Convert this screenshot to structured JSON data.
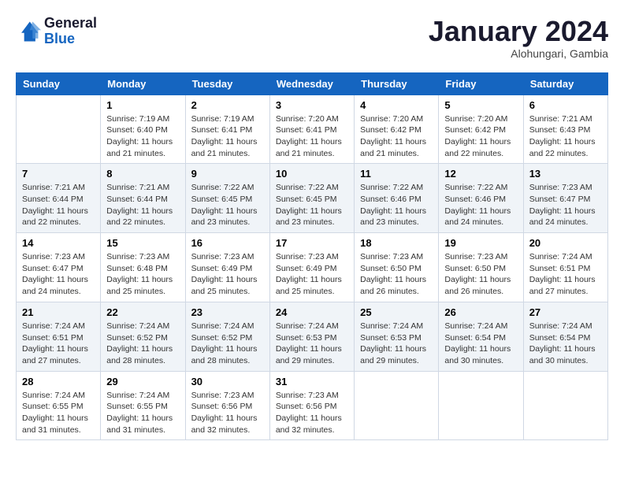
{
  "header": {
    "logo_general": "General",
    "logo_blue": "Blue",
    "month_title": "January 2024",
    "subtitle": "Alohungari, Gambia"
  },
  "weekdays": [
    "Sunday",
    "Monday",
    "Tuesday",
    "Wednesday",
    "Thursday",
    "Friday",
    "Saturday"
  ],
  "weeks": [
    [
      {
        "day": null
      },
      {
        "day": 1,
        "sunrise": "7:19 AM",
        "sunset": "6:40 PM",
        "daylight": "11 hours and 21 minutes."
      },
      {
        "day": 2,
        "sunrise": "7:19 AM",
        "sunset": "6:41 PM",
        "daylight": "11 hours and 21 minutes."
      },
      {
        "day": 3,
        "sunrise": "7:20 AM",
        "sunset": "6:41 PM",
        "daylight": "11 hours and 21 minutes."
      },
      {
        "day": 4,
        "sunrise": "7:20 AM",
        "sunset": "6:42 PM",
        "daylight": "11 hours and 21 minutes."
      },
      {
        "day": 5,
        "sunrise": "7:20 AM",
        "sunset": "6:42 PM",
        "daylight": "11 hours and 22 minutes."
      },
      {
        "day": 6,
        "sunrise": "7:21 AM",
        "sunset": "6:43 PM",
        "daylight": "11 hours and 22 minutes."
      }
    ],
    [
      {
        "day": 7,
        "sunrise": "7:21 AM",
        "sunset": "6:44 PM",
        "daylight": "11 hours and 22 minutes."
      },
      {
        "day": 8,
        "sunrise": "7:21 AM",
        "sunset": "6:44 PM",
        "daylight": "11 hours and 22 minutes."
      },
      {
        "day": 9,
        "sunrise": "7:22 AM",
        "sunset": "6:45 PM",
        "daylight": "11 hours and 23 minutes."
      },
      {
        "day": 10,
        "sunrise": "7:22 AM",
        "sunset": "6:45 PM",
        "daylight": "11 hours and 23 minutes."
      },
      {
        "day": 11,
        "sunrise": "7:22 AM",
        "sunset": "6:46 PM",
        "daylight": "11 hours and 23 minutes."
      },
      {
        "day": 12,
        "sunrise": "7:22 AM",
        "sunset": "6:46 PM",
        "daylight": "11 hours and 24 minutes."
      },
      {
        "day": 13,
        "sunrise": "7:23 AM",
        "sunset": "6:47 PM",
        "daylight": "11 hours and 24 minutes."
      }
    ],
    [
      {
        "day": 14,
        "sunrise": "7:23 AM",
        "sunset": "6:47 PM",
        "daylight": "11 hours and 24 minutes."
      },
      {
        "day": 15,
        "sunrise": "7:23 AM",
        "sunset": "6:48 PM",
        "daylight": "11 hours and 25 minutes."
      },
      {
        "day": 16,
        "sunrise": "7:23 AM",
        "sunset": "6:49 PM",
        "daylight": "11 hours and 25 minutes."
      },
      {
        "day": 17,
        "sunrise": "7:23 AM",
        "sunset": "6:49 PM",
        "daylight": "11 hours and 25 minutes."
      },
      {
        "day": 18,
        "sunrise": "7:23 AM",
        "sunset": "6:50 PM",
        "daylight": "11 hours and 26 minutes."
      },
      {
        "day": 19,
        "sunrise": "7:23 AM",
        "sunset": "6:50 PM",
        "daylight": "11 hours and 26 minutes."
      },
      {
        "day": 20,
        "sunrise": "7:24 AM",
        "sunset": "6:51 PM",
        "daylight": "11 hours and 27 minutes."
      }
    ],
    [
      {
        "day": 21,
        "sunrise": "7:24 AM",
        "sunset": "6:51 PM",
        "daylight": "11 hours and 27 minutes."
      },
      {
        "day": 22,
        "sunrise": "7:24 AM",
        "sunset": "6:52 PM",
        "daylight": "11 hours and 28 minutes."
      },
      {
        "day": 23,
        "sunrise": "7:24 AM",
        "sunset": "6:52 PM",
        "daylight": "11 hours and 28 minutes."
      },
      {
        "day": 24,
        "sunrise": "7:24 AM",
        "sunset": "6:53 PM",
        "daylight": "11 hours and 29 minutes."
      },
      {
        "day": 25,
        "sunrise": "7:24 AM",
        "sunset": "6:53 PM",
        "daylight": "11 hours and 29 minutes."
      },
      {
        "day": 26,
        "sunrise": "7:24 AM",
        "sunset": "6:54 PM",
        "daylight": "11 hours and 30 minutes."
      },
      {
        "day": 27,
        "sunrise": "7:24 AM",
        "sunset": "6:54 PM",
        "daylight": "11 hours and 30 minutes."
      }
    ],
    [
      {
        "day": 28,
        "sunrise": "7:24 AM",
        "sunset": "6:55 PM",
        "daylight": "11 hours and 31 minutes."
      },
      {
        "day": 29,
        "sunrise": "7:24 AM",
        "sunset": "6:55 PM",
        "daylight": "11 hours and 31 minutes."
      },
      {
        "day": 30,
        "sunrise": "7:23 AM",
        "sunset": "6:56 PM",
        "daylight": "11 hours and 32 minutes."
      },
      {
        "day": 31,
        "sunrise": "7:23 AM",
        "sunset": "6:56 PM",
        "daylight": "11 hours and 32 minutes."
      },
      {
        "day": null
      },
      {
        "day": null
      },
      {
        "day": null
      }
    ]
  ]
}
